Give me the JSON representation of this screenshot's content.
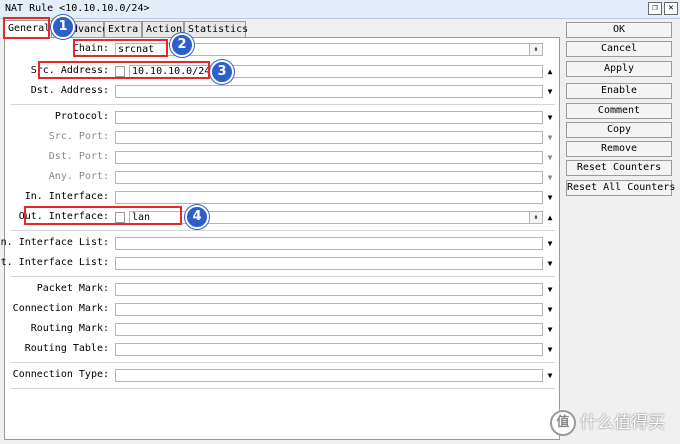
{
  "window": {
    "title": "NAT Rule <10.10.10.0/24>",
    "restore_glyph": "❐",
    "close_glyph": "✕"
  },
  "tabs": [
    {
      "label": "General",
      "active": true
    },
    {
      "label": "Advanced"
    },
    {
      "label": "Extra"
    },
    {
      "label": "Action"
    },
    {
      "label": "Statistics"
    }
  ],
  "fields": {
    "chain": {
      "label": "Chain:",
      "value": "srcnat"
    },
    "src_address": {
      "label": "Src. Address:",
      "value": "10.10.10.0/24"
    },
    "dst_address": {
      "label": "Dst. Address:",
      "value": ""
    },
    "protocol": {
      "label": "Protocol:",
      "value": ""
    },
    "src_port": {
      "label": "Src. Port:",
      "value": ""
    },
    "dst_port": {
      "label": "Dst. Port:",
      "value": ""
    },
    "any_port": {
      "label": "Any. Port:",
      "value": ""
    },
    "in_interface": {
      "label": "In. Interface:",
      "value": ""
    },
    "out_interface": {
      "label": "Out. Interface:",
      "value": "lan"
    },
    "in_interface_list": {
      "label": "In. Interface List:",
      "value": ""
    },
    "out_interface_list": {
      "label": "Out. Interface List:",
      "value": ""
    },
    "packet_mark": {
      "label": "Packet Mark:",
      "value": ""
    },
    "connection_mark": {
      "label": "Connection Mark:",
      "value": ""
    },
    "routing_mark": {
      "label": "Routing Mark:",
      "value": ""
    },
    "routing_table": {
      "label": "Routing Table:",
      "value": ""
    },
    "connection_type": {
      "label": "Connection Type:",
      "value": ""
    }
  },
  "glyphs": {
    "dropdown": "▼",
    "collapse": "▲",
    "spinner": "⇟"
  },
  "buttons": {
    "ok": "OK",
    "cancel": "Cancel",
    "apply": "Apply",
    "enable": "Enable",
    "comment": "Comment",
    "copy": "Copy",
    "remove": "Remove",
    "reset_counters": "Reset Counters",
    "reset_all_counters": "Reset All Counters"
  },
  "annotations": [
    "1",
    "2",
    "3",
    "4"
  ],
  "watermark": {
    "logo": "值",
    "text": "什么值得买"
  },
  "colors": {
    "highlight": "#e52828",
    "badge": "#2d5fc9"
  }
}
